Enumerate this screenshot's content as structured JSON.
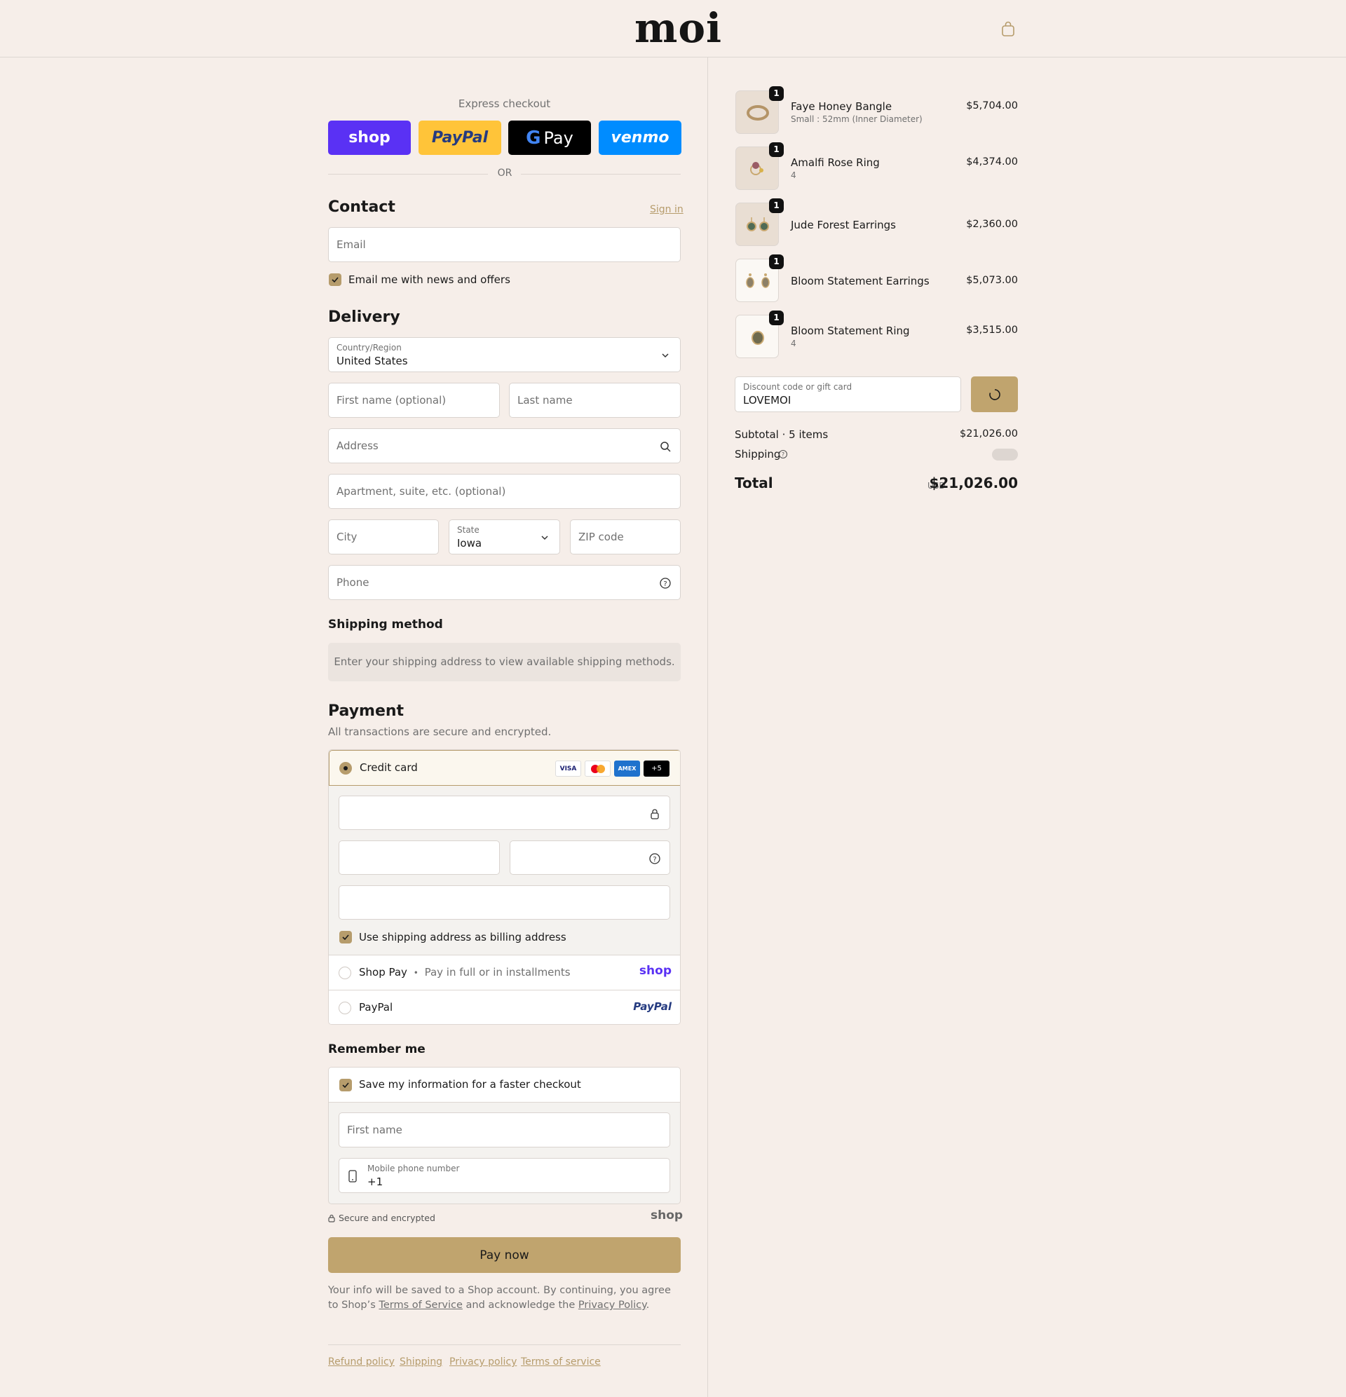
{
  "brand": {
    "name": "moi",
    "accent": "#b69c6c"
  },
  "express": {
    "title": "Express checkout",
    "shop": "shop",
    "paypal": "PayPal",
    "gpay": "Pay",
    "venmo": "venmo",
    "or": "OR"
  },
  "contact": {
    "title": "Contact",
    "sign_in": "Sign in",
    "email_placeholder": "Email",
    "news_label": "Email me with news and offers"
  },
  "delivery": {
    "title": "Delivery",
    "country_label": "Country/Region",
    "country_value": "United States",
    "first_name_placeholder": "First name (optional)",
    "last_name_placeholder": "Last name",
    "address_placeholder": "Address",
    "apartment_placeholder": "Apartment, suite, etc. (optional)",
    "city_placeholder": "City",
    "state_label": "State",
    "state_value": "Iowa",
    "zip_placeholder": "ZIP code",
    "phone_placeholder": "Phone"
  },
  "shipping_method": {
    "title": "Shipping method",
    "message": "Enter your shipping address to view available shipping methods."
  },
  "payment": {
    "title": "Payment",
    "subtitle": "All transactions are secure and encrypted.",
    "credit_card": "Credit card",
    "cards": [
      "VISA",
      "",
      "AMEX",
      "+5"
    ],
    "billing_label": "Use shipping address as billing address",
    "shop_pay": "Shop Pay",
    "shop_pay_note": "Pay in full or in installments",
    "shop_logo": "shop",
    "paypal": "PayPal",
    "paypal_logo": "PayPal"
  },
  "remember": {
    "title": "Remember me",
    "save_label": "Save my information for a faster checkout",
    "first_name_placeholder": "First name",
    "mobile_label": "Mobile phone number",
    "mobile_value": "+1"
  },
  "secure": {
    "text": "Secure and encrypted",
    "shop_logo": "shop"
  },
  "pay_now": "Pay now",
  "legal": {
    "text": "Your info will be saved to a Shop account. By continuing, you agree to Shop’s",
    "terms": "Terms of Service",
    "and": "and acknowledge the",
    "privacy": "Privacy Policy",
    "end": "."
  },
  "footer": [
    "Refund policy",
    "Shipping",
    "Privacy policy",
    "Terms of service"
  ],
  "items": [
    {
      "name": "Faye Honey Bangle",
      "variant": "Small : 52mm (Inner Diameter)",
      "price": "$5,704.00",
      "qty": "1"
    },
    {
      "name": "Amalfi Rose Ring",
      "variant": "4",
      "price": "$4,374.00",
      "qty": "1"
    },
    {
      "name": "Jude Forest Earrings",
      "variant": "",
      "price": "$2,360.00",
      "qty": "1"
    },
    {
      "name": "Bloom Statement Earrings",
      "variant": "",
      "price": "$5,073.00",
      "qty": "1"
    },
    {
      "name": "Bloom Statement Ring",
      "variant": "4",
      "price": "$3,515.00",
      "qty": "1"
    }
  ],
  "discount": {
    "label": "Discount code or gift card",
    "value": "LOVEMOI"
  },
  "summary": {
    "subtotal_label": "Subtotal · 5 items",
    "subtotal": "$21,026.00",
    "shipping_label": "Shipping",
    "total_label": "Total",
    "currency": "USD",
    "total": "$21,026.00"
  }
}
